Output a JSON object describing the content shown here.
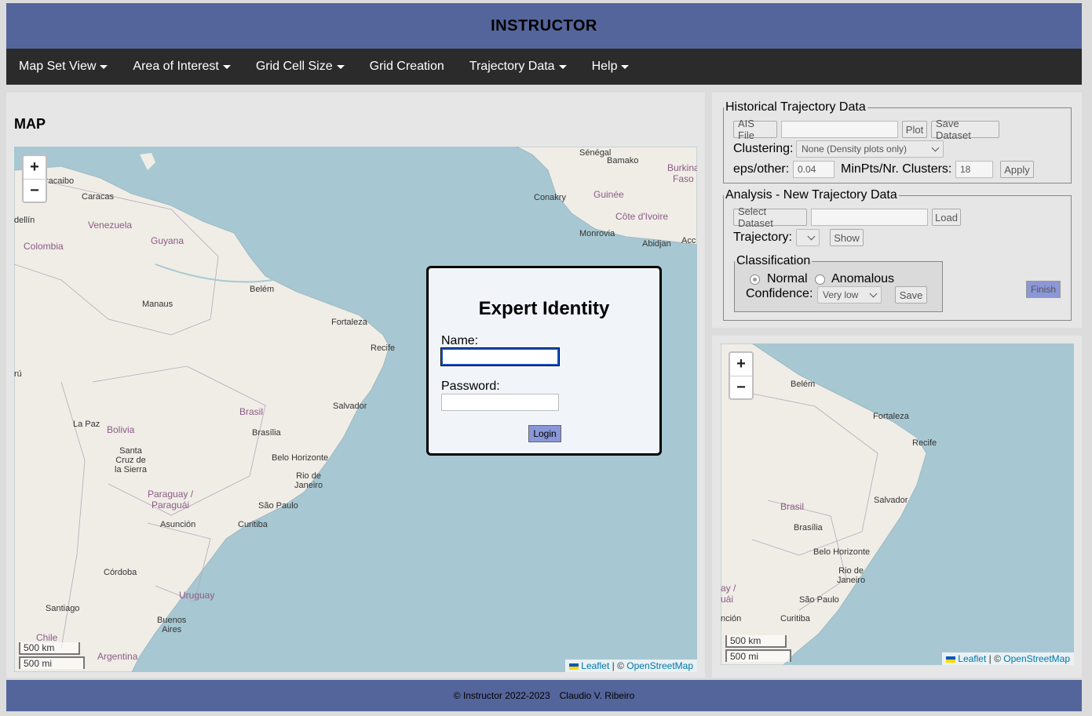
{
  "header": {
    "title": "INSTRUCTOR"
  },
  "nav": [
    {
      "label": "Map Set View",
      "dropdown": true
    },
    {
      "label": "Area of Interest",
      "dropdown": true
    },
    {
      "label": "Grid Cell Size",
      "dropdown": true
    },
    {
      "label": "Grid Creation",
      "dropdown": false
    },
    {
      "label": "Trajectory Data",
      "dropdown": true
    },
    {
      "label": "Help",
      "dropdown": true
    }
  ],
  "map_panel": {
    "title": "MAP",
    "scale_km": "500 km",
    "scale_mi": "500 mi",
    "attribution_leaflet": "Leaflet",
    "attribution_sep": "| ©",
    "attribution_osm": "OpenStreetMap",
    "cities": [
      "Sénégal",
      "Bamako",
      "Burkina Faso",
      "Conakry",
      "Guinée",
      "Côte d'Ivoire",
      "Monrovia",
      "Abidjan",
      "Acc",
      "racaibo",
      "Caracas",
      "dellín",
      "Venezuela",
      "Guyana",
      "Colombia",
      "Belém",
      "Manaus",
      "Fortaleza",
      "Recife",
      "rú",
      "Brasil",
      "Salvador",
      "Brasília",
      "La Paz",
      "Bolivia",
      "Santa Cruz de la Sierra",
      "Belo Horizonte",
      "Rio de Janeiro",
      "Paraguay / Paraguái",
      "São Paulo",
      "Asunción",
      "Curitiba",
      "Córdoba",
      "Uruguay",
      "Santiago",
      "Buenos Aires",
      "Chile",
      "Argentina"
    ]
  },
  "modal": {
    "title": "Expert Identity",
    "name_label": "Name:",
    "password_label": "Password:",
    "name_value": "",
    "password_value": "",
    "login_label": "Login"
  },
  "historical": {
    "legend": "Historical Trajectory Data",
    "ais_file_label": "AIS File",
    "ais_file_value": "",
    "plot_label": "Plot",
    "save_dataset_label": "Save Dataset",
    "clustering_label": "Clustering:",
    "clustering_value": "None (Density plots only)",
    "eps_label": "eps/other:",
    "eps_value": "0.04",
    "minpts_label": "MinPts/Nr. Clusters:",
    "minpts_value": "18",
    "apply_label": "Apply"
  },
  "analysis": {
    "legend": "Analysis - New Trajectory Data",
    "select_dataset_label": "Select Dataset",
    "dataset_value": "",
    "load_label": "Load",
    "trajectory_label": "Trajectory:",
    "trajectory_value": "",
    "show_label": "Show",
    "classification": {
      "legend": "Classification",
      "normal_label": "Normal",
      "anomalous_label": "Anomalous",
      "selected": "Normal",
      "confidence_label": "Confidence:",
      "confidence_value": "Very low",
      "save_label": "Save"
    },
    "finish_label": "Finish"
  },
  "mini_map": {
    "scale_km": "500 km",
    "scale_mi": "500 mi",
    "attribution_leaflet": "Leaflet",
    "attribution_sep": "| ©",
    "attribution_osm": "OpenStreetMap",
    "cities": [
      "Belém",
      "Fortaleza",
      "Recife",
      "Brasil",
      "Brasília",
      "Salvador",
      "Belo Horizonte",
      "Rio de Janeiro",
      "São Paulo",
      "Curitiba",
      "ay /",
      "uái",
      "nción"
    ]
  },
  "footer": {
    "copyright": "© Instructor 2022-2023",
    "author": "Claudio V. Ribeiro"
  },
  "colors": {
    "header": "#54659b",
    "nav": "#2b2b2b",
    "ocean": "#a7c8d2",
    "land": "#f0ede7",
    "button_accent": "#8997d8"
  }
}
